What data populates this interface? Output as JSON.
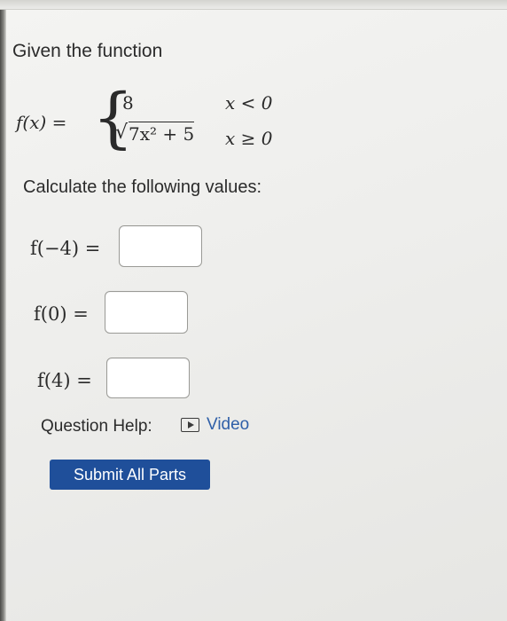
{
  "prompt": "Given the function",
  "function": {
    "lhs": "f(x) =",
    "case1": {
      "expr": "8",
      "cond": "x < 0"
    },
    "case2": {
      "radicand": "7x² + 5",
      "cond": "x ≥ 0"
    }
  },
  "instruction": "Calculate the following values:",
  "questions": [
    {
      "label": "f(−4) =",
      "value": ""
    },
    {
      "label": "f(0) =",
      "value": ""
    },
    {
      "label": "f(4) =",
      "value": ""
    }
  ],
  "help": {
    "label": "Question Help:",
    "video_label": "Video",
    "video_icon": "play-video-icon"
  },
  "submit_label": "Submit All Parts",
  "colors": {
    "submit_button": "#1f4f9a",
    "link": "#2f5fa8",
    "box_border": "#9a9a96"
  }
}
